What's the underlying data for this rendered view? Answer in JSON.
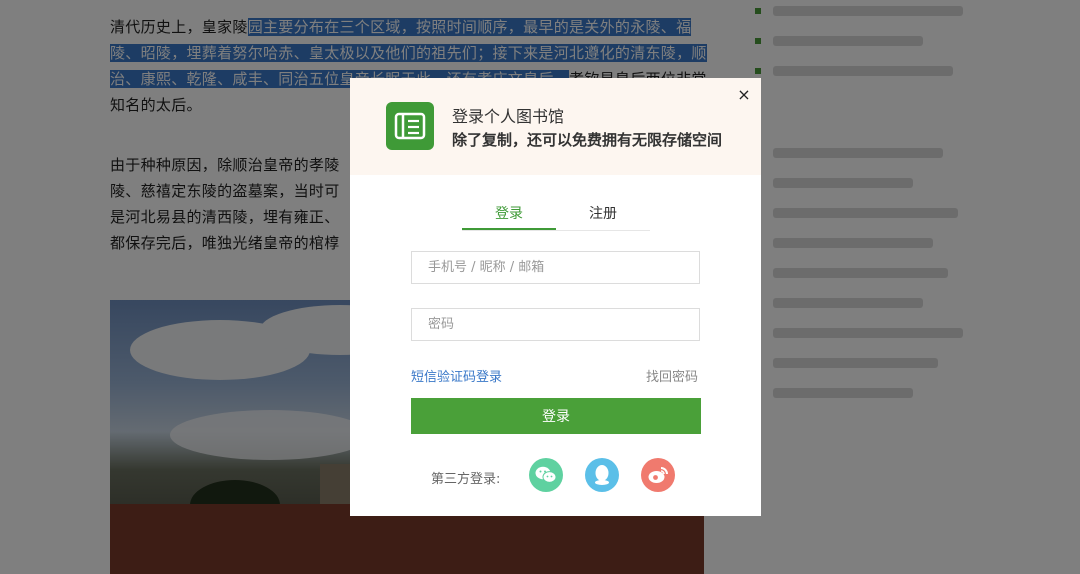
{
  "article": {
    "para1_plain": "清代历史上，皇家陵",
    "para1_highlighted": "园主要分布在三个区域，按照时间顺序，最早的是关外的永陵、福陵、昭陵，埋葬着努尔哈赤、皇太极以及他们的祖先们；接下来是河北遵化的清东陵，顺治、康熙、乾隆、咸丰、同治五位皇帝长眠于此，还有孝庄文皇后、",
    "para1_tail": "孝钦显皇后两位非常知名的太后。",
    "para2_lines": [
      "由于种种原因，除顺治皇帝的孝陵",
      "陵、慈禧定东陵的盗墓案，当时可",
      "是河北易县的清西陵，埋有雍正、",
      "都保存完后，唯独光绪皇帝的棺椁"
    ]
  },
  "modal": {
    "title": "登录个人图书馆",
    "subtitle": "除了复制，还可以免费拥有无限存储空间",
    "close_symbol": "×",
    "tabs": [
      {
        "label": "登录",
        "active": true
      },
      {
        "label": "注册",
        "active": false
      }
    ],
    "username_placeholder": "手机号 / 昵称 / 邮箱",
    "password_placeholder": "密码",
    "sms_login_label": "短信验证码登录",
    "forgot_password_label": "找回密码",
    "login_button_label": "登录",
    "third_party_label": "第三方登录:",
    "social": [
      {
        "name": "wechat-icon",
        "color": "#5fd1a0"
      },
      {
        "name": "qq-icon",
        "color": "#5bbfe8"
      },
      {
        "name": "weibo-icon",
        "color": "#f07a6e"
      }
    ],
    "accent_color": "#4aa039"
  }
}
